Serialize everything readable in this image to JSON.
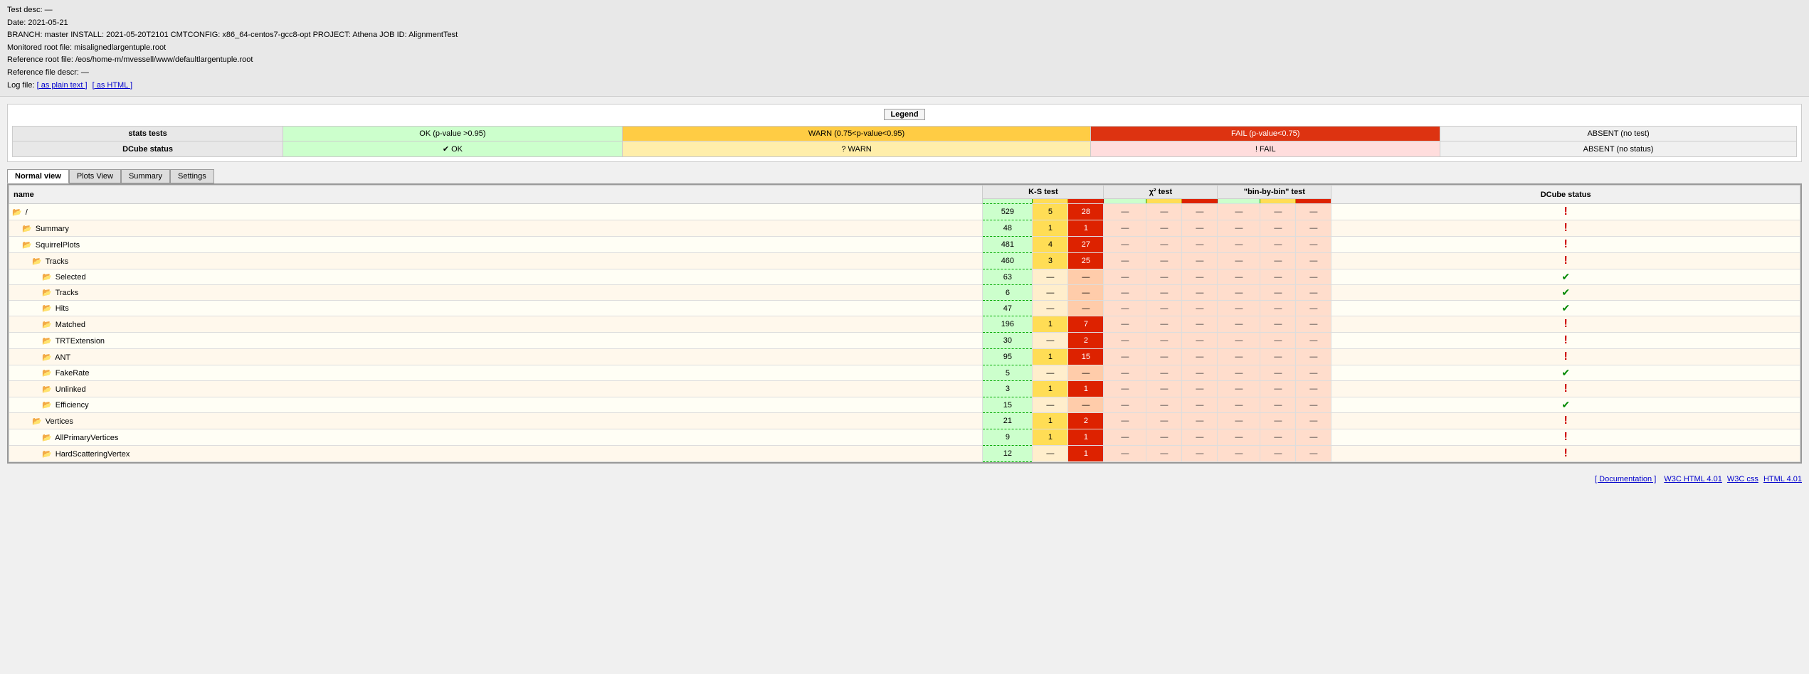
{
  "header": {
    "test_desc": "Test desc: —",
    "date": "Date: 2021-05-21",
    "branch": "BRANCH: master INSTALL: 2021-05-20T2101 CMTCONFIG: x86_64-centos7-gcc8-opt PROJECT: Athena JOB ID: AlignmentTest",
    "monitored": "Monitored root file: misalignedlargentuple.root",
    "reference": "Reference root file: /eos/home-m/mvessell/www/defaultlargentuple.root",
    "ref_desc": "Reference file descr: —",
    "log_label": "Log file:",
    "log_plain": "[ as plain text ]",
    "log_html": "[ as HTML ]"
  },
  "legend": {
    "title": "Legend",
    "rows": [
      {
        "label": "stats tests",
        "ok": "OK (p-value >0.95)",
        "warn": "WARN (0.75<p-value<0.95)",
        "fail": "FAIL (p-value<0.75)",
        "absent": "ABSENT (no test)"
      },
      {
        "label": "DCube status",
        "ok": "✔ OK",
        "warn": "? WARN",
        "fail": "! FAIL",
        "absent": "ABSENT (no status)"
      }
    ]
  },
  "tabs": [
    "Normal view",
    "Plots View",
    "Summary",
    "Settings"
  ],
  "active_tab": "Normal view",
  "table": {
    "headers": {
      "name": "name",
      "ks": "K-S test",
      "chi": "χ² test",
      "bin": "\"bin-by-bin\" test",
      "dcube": "DCube status"
    },
    "sub_headers": [
      "",
      "",
      "",
      "",
      "",
      "",
      "",
      "",
      "",
      "",
      ""
    ],
    "rows": [
      {
        "id": "root",
        "indent": 0,
        "type": "folder-open",
        "name": "/",
        "num": "529",
        "ks1": "5",
        "ks2": "28",
        "ks1_class": "yellow",
        "ks2_class": "red",
        "chi1": "—",
        "chi2": "—",
        "chi3": "—",
        "bin1": "—",
        "bin2": "—",
        "bin3": "—",
        "dcube": "fail"
      },
      {
        "id": "summary",
        "indent": 1,
        "type": "folder",
        "name": "Summary",
        "num": "48",
        "ks1": "1",
        "ks2": "1",
        "ks1_class": "yellow",
        "ks2_class": "red",
        "chi1": "—",
        "chi2": "—",
        "chi3": "—",
        "bin1": "—",
        "bin2": "—",
        "bin3": "—",
        "dcube": "fail"
      },
      {
        "id": "squirrelplots",
        "indent": 1,
        "type": "folder",
        "name": "SquirrelPlots",
        "num": "481",
        "ks1": "4",
        "ks2": "27",
        "ks1_class": "yellow",
        "ks2_class": "red",
        "chi1": "—",
        "chi2": "—",
        "chi3": "—",
        "bin1": "—",
        "bin2": "—",
        "bin3": "—",
        "dcube": "fail"
      },
      {
        "id": "tracks",
        "indent": 2,
        "type": "folder",
        "name": "Tracks",
        "num": "460",
        "ks1": "3",
        "ks2": "25",
        "ks1_class": "yellow",
        "ks2_class": "red",
        "chi1": "—",
        "chi2": "—",
        "chi3": "—",
        "bin1": "—",
        "bin2": "—",
        "bin3": "—",
        "dcube": "fail"
      },
      {
        "id": "selected",
        "indent": 3,
        "type": "folder",
        "name": "Selected",
        "num": "63",
        "ks1": "—",
        "ks2": "—",
        "ks1_class": "",
        "ks2_class": "",
        "chi1": "—",
        "chi2": "—",
        "chi3": "—",
        "bin1": "—",
        "bin2": "—",
        "bin3": "—",
        "dcube": "ok"
      },
      {
        "id": "tracks2",
        "indent": 3,
        "type": "folder",
        "name": "Tracks",
        "num": "6",
        "ks1": "—",
        "ks2": "—",
        "ks1_class": "",
        "ks2_class": "",
        "chi1": "—",
        "chi2": "—",
        "chi3": "—",
        "bin1": "—",
        "bin2": "—",
        "bin3": "—",
        "dcube": "ok"
      },
      {
        "id": "hits",
        "indent": 3,
        "type": "folder",
        "name": "Hits",
        "num": "47",
        "ks1": "—",
        "ks2": "—",
        "ks1_class": "",
        "ks2_class": "",
        "chi1": "—",
        "chi2": "—",
        "chi3": "—",
        "bin1": "—",
        "bin2": "—",
        "bin3": "—",
        "dcube": "ok"
      },
      {
        "id": "matched",
        "indent": 3,
        "type": "folder",
        "name": "Matched",
        "num": "196",
        "ks1": "1",
        "ks2": "7",
        "ks1_class": "yellow",
        "ks2_class": "red",
        "chi1": "—",
        "chi2": "—",
        "chi3": "—",
        "bin1": "—",
        "bin2": "—",
        "bin3": "—",
        "dcube": "fail"
      },
      {
        "id": "trtextension",
        "indent": 3,
        "type": "folder",
        "name": "TRTExtension",
        "num": "30",
        "ks1": "—",
        "ks2": "2",
        "ks1_class": "",
        "ks2_class": "red",
        "chi1": "—",
        "chi2": "—",
        "chi3": "—",
        "bin1": "—",
        "bin2": "—",
        "bin3": "—",
        "dcube": "fail"
      },
      {
        "id": "ant",
        "indent": 3,
        "type": "folder",
        "name": "ANT",
        "num": "95",
        "ks1": "1",
        "ks2": "15",
        "ks1_class": "yellow",
        "ks2_class": "red",
        "chi1": "—",
        "chi2": "—",
        "chi3": "—",
        "bin1": "—",
        "bin2": "—",
        "bin3": "—",
        "dcube": "fail"
      },
      {
        "id": "fakerate",
        "indent": 3,
        "type": "folder",
        "name": "FakeRate",
        "num": "5",
        "ks1": "—",
        "ks2": "—",
        "ks1_class": "",
        "ks2_class": "",
        "chi1": "—",
        "chi2": "—",
        "chi3": "—",
        "bin1": "—",
        "bin2": "—",
        "bin3": "—",
        "dcube": "ok"
      },
      {
        "id": "unlinked",
        "indent": 3,
        "type": "folder",
        "name": "Unlinked",
        "num": "3",
        "ks1": "1",
        "ks2": "1",
        "ks1_class": "yellow",
        "ks2_class": "red",
        "chi1": "—",
        "chi2": "—",
        "chi3": "—",
        "bin1": "—",
        "bin2": "—",
        "bin3": "—",
        "dcube": "fail"
      },
      {
        "id": "efficiency",
        "indent": 3,
        "type": "folder",
        "name": "Efficiency",
        "num": "15",
        "ks1": "—",
        "ks2": "—",
        "ks1_class": "",
        "ks2_class": "",
        "chi1": "—",
        "chi2": "—",
        "chi3": "—",
        "bin1": "—",
        "bin2": "—",
        "bin3": "—",
        "dcube": "ok"
      },
      {
        "id": "vertices",
        "indent": 2,
        "type": "folder",
        "name": "Vertices",
        "num": "21",
        "ks1": "1",
        "ks2": "2",
        "ks1_class": "yellow",
        "ks2_class": "red",
        "chi1": "—",
        "chi2": "—",
        "chi3": "—",
        "bin1": "—",
        "bin2": "—",
        "bin3": "—",
        "dcube": "fail"
      },
      {
        "id": "allprimary",
        "indent": 3,
        "type": "folder",
        "name": "AllPrimaryVertices",
        "num": "9",
        "ks1": "1",
        "ks2": "1",
        "ks1_class": "yellow",
        "ks2_class": "red",
        "chi1": "—",
        "chi2": "—",
        "chi3": "—",
        "bin1": "—",
        "bin2": "—",
        "bin3": "—",
        "dcube": "fail"
      },
      {
        "id": "hardscattering",
        "indent": 3,
        "type": "folder",
        "name": "HardScatteringVertex",
        "num": "12",
        "ks1": "—",
        "ks2": "1",
        "ks1_class": "",
        "ks2_class": "red",
        "chi1": "—",
        "chi2": "—",
        "chi3": "—",
        "bin1": "—",
        "bin2": "—",
        "bin3": "—",
        "dcube": "fail"
      }
    ]
  },
  "footer": {
    "doc_link": "[ Documentation ]",
    "w3c_html": "W3C HTML 4.01",
    "w3c_css": "W3C css",
    "w3c_html2": "HTML 4.01"
  }
}
